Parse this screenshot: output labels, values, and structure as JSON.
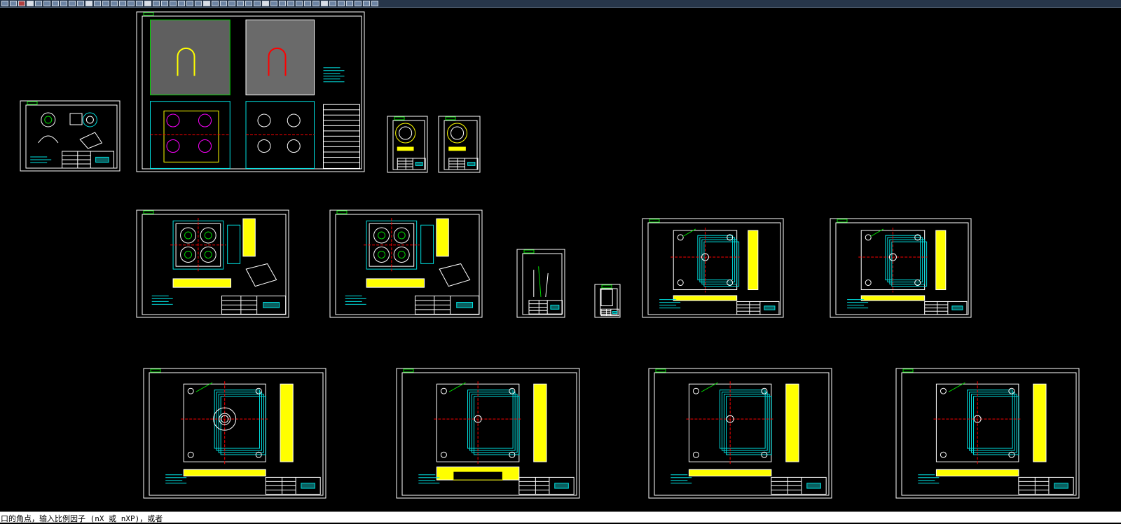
{
  "command_line": {
    "prompt_text": "口的角点，输入比例因子 (nX 或 nXP)，或者"
  },
  "toolbar": {
    "icons": [
      "new-icon",
      "open-icon",
      "save-icon",
      "plot-icon",
      "preview-icon",
      "publish-icon",
      "cut-icon",
      "copy-icon",
      "paste-icon",
      "match-properties-icon",
      "undo-icon",
      "redo-icon",
      "pan-icon",
      "zoom-realtime-icon",
      "zoom-window-icon",
      "zoom-previous-icon",
      "properties-icon",
      "design-center-icon",
      "tool-palettes-icon",
      "sheet-set-icon",
      "markup-icon",
      "calculator-icon",
      "layer-icon",
      "layer-previous-icon",
      "line-icon",
      "polyline-icon",
      "circle-icon",
      "arc-icon",
      "rectangle-icon",
      "hatch-icon",
      "text-icon",
      "dimension-icon",
      "block-icon",
      "insert-icon",
      "move-icon",
      "copy-object-icon",
      "rotate-icon",
      "scale-icon",
      "mirror-icon",
      "offset-icon",
      "trim-icon",
      "extend-icon",
      "fillet-icon",
      "explode-icon",
      "help-icon"
    ]
  },
  "colors": {
    "model_background": "#000000",
    "frame": "#ffffff",
    "geometry_green": "#00d400",
    "geometry_cyan": "#00e0e0",
    "geometry_yellow": "#ffff00",
    "centerline_red": "#ff0000",
    "geometry_magenta": "#ff00ff",
    "command_bar": "#ffffff"
  },
  "drawings": [
    {
      "name": "product-drawing",
      "kind": "product"
    },
    {
      "name": "mold-assembly-drawing",
      "kind": "assembly"
    },
    {
      "name": "ring-part-drawing",
      "kind": "small-part"
    },
    {
      "name": "pin-part-drawing",
      "kind": "small-part"
    },
    {
      "name": "cavity-insert-drawing",
      "kind": "cavity"
    },
    {
      "name": "core-insert-drawing",
      "kind": "cavity"
    },
    {
      "name": "thin-part-drawing",
      "kind": "sketch"
    },
    {
      "name": "small-sketch-drawing",
      "kind": "small-sketch"
    },
    {
      "name": "a-plate-drawing",
      "kind": "plate"
    },
    {
      "name": "b-plate-drawing",
      "kind": "plate"
    },
    {
      "name": "top-clamp-plate-drawing",
      "kind": "plate-centered"
    },
    {
      "name": "ejector-plate-drawing",
      "kind": "plate-u"
    },
    {
      "name": "support-plate-drawing",
      "kind": "plate"
    },
    {
      "name": "bottom-clamp-plate-drawing",
      "kind": "plate-simple"
    }
  ]
}
